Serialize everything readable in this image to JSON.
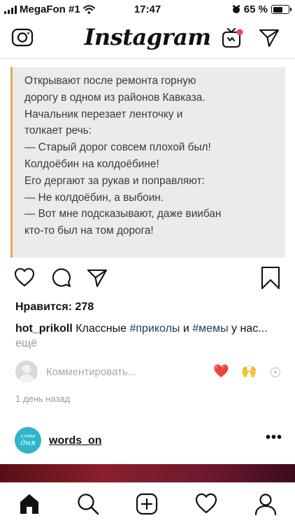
{
  "status_bar": {
    "carrier": "MegaFon #1",
    "time": "17:47",
    "battery_text": "65 %",
    "battery_level": 0.65
  },
  "header": {
    "logo": "Instagram"
  },
  "post": {
    "image_text_lines": [
      "Открывают после ремонта горную",
      "дорогу в одном из районов Кавказа.",
      "Начальник перезает ленточку и",
      "толкает речь:",
      "— Старый дорог совсем плохой был!",
      "Колдоёбин на колдоёбине!",
      "Его дергают за рукав и поправляют:",
      "— Не колдоёбин, а выбоин.",
      "— Вот мне подсказывают, даже виибан",
      "кто-то был на том дорога!"
    ],
    "likes": "Нравится: 278",
    "caption": {
      "username": "hot_prikoll",
      "text_1": " Классные ",
      "tag_1": "#приколы",
      "text_2": " и ",
      "tag_2": "#мемы",
      "text_3": " у нас...",
      "more": " ещё"
    },
    "comment_placeholder": "Комментировать...",
    "reactions": [
      "❤️",
      "🙌"
    ],
    "reaction_add": "+",
    "timestamp": "1 день назад"
  },
  "next_post": {
    "avatar_line_1": "слово",
    "avatar_line_2": "дня",
    "username": "words_on",
    "more": "•••"
  },
  "colors": {
    "accent_tag": "#1e3b6e",
    "notification_dot": "#ed4956",
    "quote_bar": "#e2a955"
  }
}
